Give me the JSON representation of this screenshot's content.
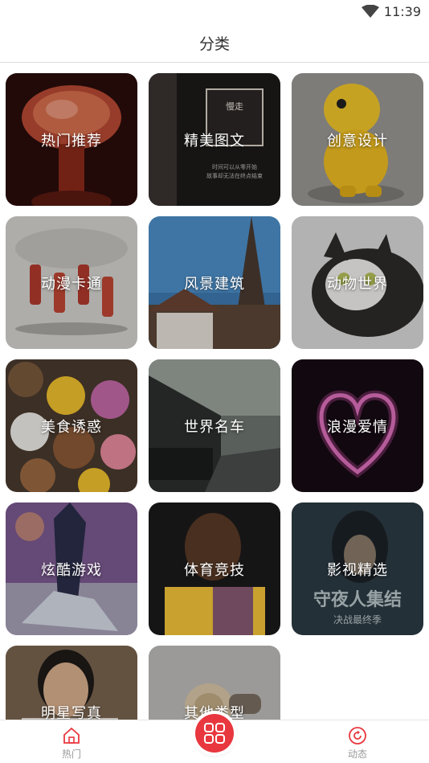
{
  "status": {
    "time": "11:39"
  },
  "header": {
    "title": "分类"
  },
  "categories": [
    {
      "label": "热门推荐",
      "art": "mushroom-cloud"
    },
    {
      "label": "精美图文",
      "art": "lightbox-sign",
      "sign_text": "慢走",
      "caption_1": "时间可以从零开始",
      "caption_2": "故事却无法在终点结束"
    },
    {
      "label": "创意设计",
      "art": "yellow-toy-dino"
    },
    {
      "label": "动漫卡通",
      "art": "basketball-players"
    },
    {
      "label": "风景建筑",
      "art": "church-spire"
    },
    {
      "label": "动物世界",
      "art": "kitten"
    },
    {
      "label": "美食诱惑",
      "art": "character-cookies"
    },
    {
      "label": "世界名车",
      "art": "car-on-road"
    },
    {
      "label": "浪漫爱情",
      "art": "glowing-heart"
    },
    {
      "label": "炫酷游戏",
      "art": "game-warrior"
    },
    {
      "label": "体育竞技",
      "art": "basketball-star"
    },
    {
      "label": "影视精选",
      "art": "tv-poster",
      "poster_title": "守夜人集结",
      "poster_subtitle": "决战最终季"
    },
    {
      "label": "明星写真",
      "art": "celebrity-portrait"
    },
    {
      "label": "其他类型",
      "art": "snail"
    }
  ],
  "tabbar": {
    "hot_label": "热门",
    "center_icon": "grid-icon",
    "feed_label": "动态"
  },
  "colors": {
    "accent": "#e8373e"
  }
}
